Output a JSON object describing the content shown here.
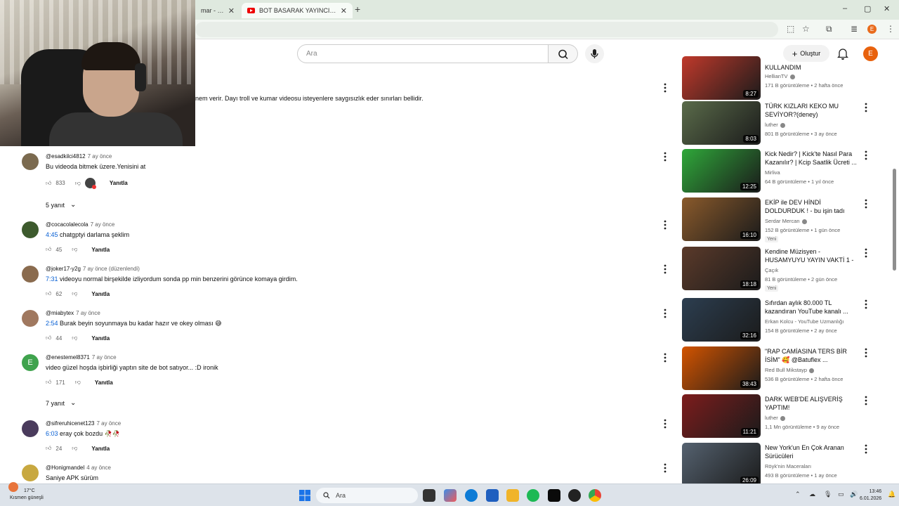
{
  "browser": {
    "tabs": [
      {
        "title": "mar - 3. Se",
        "active": false
      },
      {
        "title": "BOT BASARAK YAYINCI OLMAK",
        "active": true
      }
    ],
    "new_tab": "+",
    "window_controls": {
      "minimize": "–",
      "maximize": "▢",
      "close": "✕"
    },
    "profile_initial": "E"
  },
  "header": {
    "search_placeholder": "Ara",
    "create_label": "Oluştur",
    "avatar_initial": "E"
  },
  "description_fragment": "nem verir. Dayı troll ve kumar videosu isteyenlere saygısızlık eder sınırları bellidir.",
  "comments": [
    {
      "author": "@esadkilci4812",
      "time": "7 ay önce",
      "text": "Bu videoda bitmek üzere.Yenisini at",
      "timestamp": "",
      "likes": "833",
      "reply": "Yanıtla",
      "creator_heart": true,
      "replies": "5 yanıt",
      "avatar_color": "#7b6a4f"
    },
    {
      "author": "@cocacolalecola",
      "time": "7 ay önce",
      "text": "chatgptyi darlama şeklim",
      "timestamp": "4:45",
      "likes": "45",
      "reply": "Yanıtla",
      "creator_heart": false,
      "replies": "",
      "avatar_color": "#3d5a2d"
    },
    {
      "author": "@joker17-y2g",
      "time": "7 ay önce (düzenlendi)",
      "text": "videoyu normal birşekilde izliyordum sonda pp min benzerini görünce komaya girdim.",
      "timestamp": "7:31",
      "likes": "62",
      "reply": "Yanıtla",
      "creator_heart": false,
      "replies": "",
      "avatar_color": "#8a6b4e"
    },
    {
      "author": "@miabytex",
      "time": "7 ay önce",
      "text": "Burak beyin soyunmaya bu kadar hazır ve okey olması 😅",
      "timestamp": "2:54",
      "likes": "44",
      "reply": "Yanıtla",
      "creator_heart": false,
      "replies": "",
      "avatar_color": "#a0785f"
    },
    {
      "author": "@enestemel8371",
      "time": "7 ay önce",
      "text": "video güzel hoşda işbirliği yaptın site de bot satıyor... :D ironik",
      "timestamp": "",
      "likes": "171",
      "reply": "Yanıtla",
      "creator_heart": false,
      "replies": "7 yanıt",
      "avatar_color": "#3fa34d",
      "avatar_letter": "E"
    },
    {
      "author": "@sifreruhicenet123",
      "time": "7 ay önce",
      "text": "eray çok bozdu 🥀🥀",
      "timestamp": "6:03",
      "likes": "24",
      "reply": "Yanıtla",
      "creator_heart": false,
      "replies": "",
      "avatar_color": "#4a3b5c"
    },
    {
      "author": "@Honigmandel",
      "time": "4 ay önce",
      "text": "Saniye APK sürüm",
      "timestamp": "",
      "likes": "",
      "reply": "",
      "creator_heart": false,
      "replies": "",
      "avatar_color": "#c8a840"
    }
  ],
  "recommendations": [
    {
      "title": "KULLANDIM",
      "channel": "HellianTV",
      "verified": true,
      "views": "171 B görüntüleme",
      "age": "2 hafta önce",
      "duration": "8:27",
      "new": "",
      "color": "#c0392b"
    },
    {
      "title": "TÜRK KIZLARI KEKO MU SEVİYOR?(deney)",
      "channel": "luther",
      "verified": true,
      "views": "801 B görüntüleme",
      "age": "3 ay önce",
      "duration": "8:03",
      "new": "",
      "color": "#5a6b4a"
    },
    {
      "title": "Kick Nedir? | Kick'te Nasıl Para Kazanılır? | Kcip Saatlik Ücreti ...",
      "channel": "Mirliva",
      "verified": false,
      "views": "64 B görüntüleme",
      "age": "1 yıl önce",
      "duration": "12:25",
      "new": "",
      "color": "#2fa83a"
    },
    {
      "title": "EKİP ile DEV HİNDİ DOLDURDUK ! - bu işin tadı kaçtı",
      "channel": "Serdar Mercan",
      "verified": true,
      "views": "152 B görüntüleme",
      "age": "1 gün önce",
      "duration": "16:10",
      "new": "Yeni",
      "color": "#8a5a2b"
    },
    {
      "title": "Kendine Müzisyen - HUSAMYUYU YAYIN VAKTİ 1 - ...",
      "channel": "Çaçık",
      "verified": false,
      "views": "81 B görüntüleme",
      "age": "2 gün önce",
      "duration": "18:18",
      "new": "Yeni",
      "color": "#5b3a2a"
    },
    {
      "title": "Sıfırdan aylık 80.000 TL kazandıran YouTube kanalı ...",
      "channel": "Erkan Kolcu - YouTube Uzmanlığı",
      "verified": false,
      "views": "154 B görüntüleme",
      "age": "2 ay önce",
      "duration": "32:16",
      "new": "",
      "color": "#2c3e50"
    },
    {
      "title": "\"RAP CAMİASINA TERS BİR İSİM\" 🥰 @Batuflex ...",
      "channel": "Red Bull Mikstayp",
      "verified": true,
      "views": "536 B görüntüleme",
      "age": "2 hafta önce",
      "duration": "38:43",
      "new": "",
      "color": "#d35400"
    },
    {
      "title": "DARK WEB'DE ALIŞVERİŞ YAPTIM!",
      "channel": "luther",
      "verified": true,
      "views": "1,1 Mn görüntüleme",
      "age": "9 ay önce",
      "duration": "11:21",
      "new": "",
      "color": "#7d1c1c"
    },
    {
      "title": "New York'un En Çok Aranan Sürücüleri",
      "channel": "Röyk'nin Maceraları",
      "verified": false,
      "views": "493 B görüntüleme",
      "age": "1 ay önce",
      "duration": "26:09",
      "new": "",
      "color": "#556270"
    }
  ],
  "taskbar": {
    "weather_temp": "17°C",
    "weather_desc": "Kısmen güneşli",
    "search_placeholder": "Ara",
    "time": "13:46",
    "date": "6.01.2026"
  }
}
